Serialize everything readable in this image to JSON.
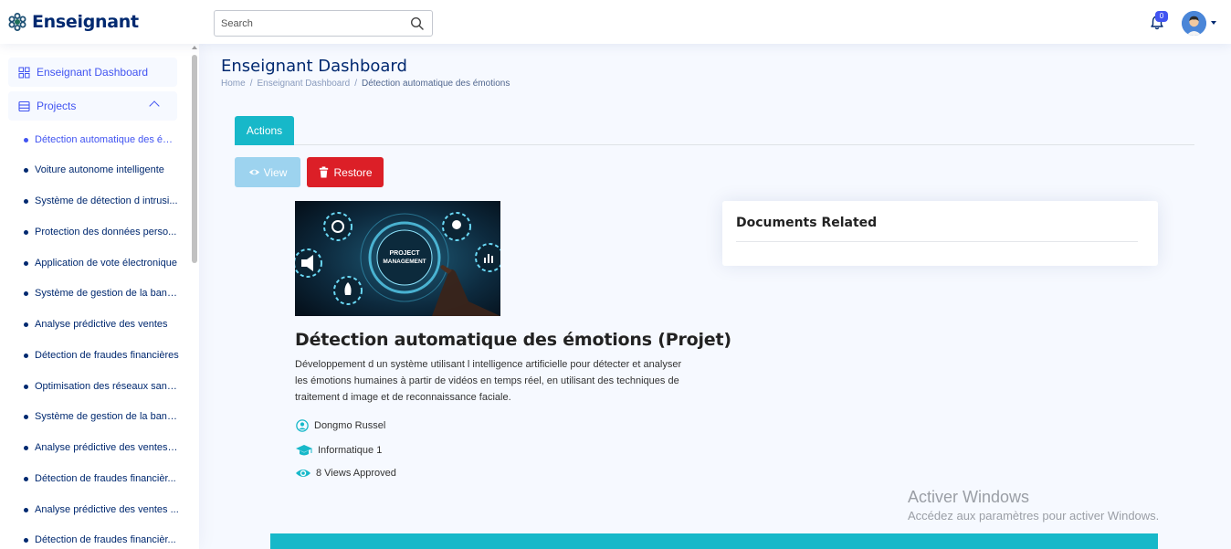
{
  "app": {
    "title": "Enseignant"
  },
  "search": {
    "placeholder": "Search"
  },
  "notifications": {
    "count": "0"
  },
  "sidebar": {
    "dashboard_label": "Enseignant Dashboard",
    "projects_label": "Projects",
    "projects": [
      "Détection automatique des ém...",
      "Voiture autonome intelligente",
      "Système de détection d intrusi...",
      "Protection des données perso...",
      "Application de vote électronique",
      "Système de gestion de la band...",
      "Analyse prédictive des ventes",
      "Détection de fraudes financières",
      "Optimisation des réseaux sans ...",
      "Système de gestion de la band...",
      "Analyse prédictive des ventes, ...",
      "Détection de fraudes financièr...",
      "Analyse prédictive des ventes ...",
      "Détection de fraudes financièr..."
    ]
  },
  "page": {
    "title": "Enseignant Dashboard",
    "breadcrumb": [
      "Home",
      "Enseignant Dashboard",
      "Détection automatique des émotions"
    ],
    "breadcrumb_sep": "/"
  },
  "tabs": {
    "actions": "Actions"
  },
  "buttons": {
    "view": "View",
    "restore": "Restore"
  },
  "project": {
    "image_text_line1": "PROJECT",
    "image_text_line2": "MANAGEMENT",
    "title": "Détection automatique des émotions (Projet)",
    "description": "Développement d un système utilisant l intelligence artificielle pour détecter et analyser les émotions humaines à partir de vidéos en temps réel, en utilisant des techniques de traitement d image et de reconnaissance faciale.",
    "author": "Dongmo Russel",
    "department": "Informatique 1",
    "views": "8 Views Approved"
  },
  "documents": {
    "title": "Documents Related"
  },
  "watermark": {
    "line1": "Activer Windows",
    "line2": "Accédez aux paramètres pour activer Windows."
  },
  "colors": {
    "brand": "#012970",
    "accent": "#4154f1",
    "teal": "#17b8c9",
    "danger": "#dc1f27",
    "view_btn": "#9dd3ef"
  }
}
